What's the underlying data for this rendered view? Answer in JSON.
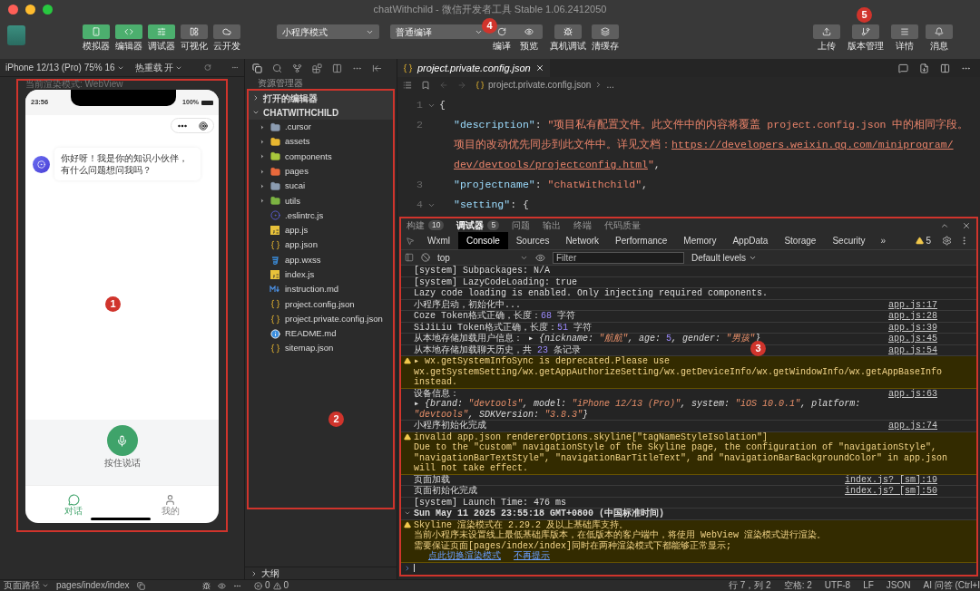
{
  "window": {
    "title": "chatWithchild - 微信开发者工具 Stable 1.06.2412050"
  },
  "toolbar": {
    "view_buttons": [
      {
        "label": "模拟器",
        "on": true
      },
      {
        "label": "编辑器",
        "on": true
      },
      {
        "label": "调试器",
        "on": true
      },
      {
        "label": "可视化",
        "on": false
      },
      {
        "label": "云开发",
        "on": false
      }
    ],
    "mode_select": "小程序模式",
    "compile_select": "普通编译",
    "compile_buttons": [
      "编译",
      "预览"
    ],
    "compile_marker": "4",
    "tool_buttons": [
      "真机调试",
      "清缓存"
    ],
    "right_buttons": [
      {
        "label": "上传"
      },
      {
        "label": "版本管理",
        "marker": "5"
      },
      {
        "label": "详情"
      },
      {
        "label": "消息"
      }
    ]
  },
  "simulator": {
    "device": "iPhone 12/13 (Pro) 75% 16",
    "hot_reload": "热重载 开",
    "render_mode": "当前渲染模式: WebView",
    "marker": "1",
    "phone": {
      "time": "23:56",
      "battery": "100%",
      "greeting": "你好呀！我是你的知识小伙伴，有什么问题想问我吗？",
      "mic_label": "按住说话",
      "tabs": [
        {
          "label": "对话",
          "selected": true
        },
        {
          "label": "我的",
          "selected": false
        }
      ]
    }
  },
  "explorer": {
    "title": "资源管理器",
    "marker": "2",
    "sections": [
      {
        "label": "打开的编辑器",
        "expanded": false
      },
      {
        "label": "CHATWITHCHILD",
        "expanded": true
      }
    ],
    "files": [
      {
        "name": ".cursor",
        "kind": "folder",
        "color": "#8b9bb0"
      },
      {
        "name": "assets",
        "kind": "folder",
        "color": "#e8b730"
      },
      {
        "name": "components",
        "kind": "folder",
        "color": "#a8c83c"
      },
      {
        "name": "pages",
        "kind": "folder",
        "color": "#e8693c"
      },
      {
        "name": "sucai",
        "kind": "folder",
        "color": "#8b9bb0"
      },
      {
        "name": "utils",
        "kind": "folder",
        "color": "#7cb342"
      },
      {
        "name": ".eslintrc.js",
        "kind": "eslint"
      },
      {
        "name": "app.js",
        "kind": "js"
      },
      {
        "name": "app.json",
        "kind": "json"
      },
      {
        "name": "app.wxss",
        "kind": "css"
      },
      {
        "name": "index.js",
        "kind": "js"
      },
      {
        "name": "instruction.md",
        "kind": "md"
      },
      {
        "name": "project.config.json",
        "kind": "json"
      },
      {
        "name": "project.private.config.json",
        "kind": "json"
      },
      {
        "name": "README.md",
        "kind": "info"
      },
      {
        "name": "sitemap.json",
        "kind": "json"
      }
    ],
    "outline": "大纲",
    "errors": "0",
    "warnings": "0"
  },
  "editor": {
    "tab": "project.private.config.json",
    "breadcrumb": "project.private.config.json",
    "breadcrumb_more": "...",
    "lines": [
      {
        "number": "1",
        "foldable": true,
        "parts": [
          {
            "text": "{",
            "kind": "punct"
          }
        ]
      },
      {
        "number": "2",
        "foldable": false,
        "parts": [
          {
            "text": "\"description\"",
            "kind": "key"
          },
          {
            "text": ": ",
            "kind": "punct"
          },
          {
            "text": "\"项目私有配置文件。此文件中的内容将覆盖 project.config.json 中的相同字段。",
            "kind": "string"
          }
        ]
      },
      {
        "foldable": false,
        "parts": [
          {
            "text": "项目的改动优先同步到此文件中。详见文档：",
            "kind": "string"
          },
          {
            "text": "https://developers.weixin.qq.com/miniprogram/",
            "kind": "link"
          }
        ]
      },
      {
        "foldable": false,
        "parts": [
          {
            "text": "dev/devtools/projectconfig.html",
            "kind": "link"
          },
          {
            "text": "\"",
            "kind": "string"
          },
          {
            "text": ",",
            "kind": "punct"
          }
        ]
      },
      {
        "number": "3",
        "foldable": false,
        "parts": [
          {
            "text": "\"projectname\"",
            "kind": "key"
          },
          {
            "text": ": ",
            "kind": "punct"
          },
          {
            "text": "\"chatWithchild\"",
            "kind": "string"
          },
          {
            "text": ",",
            "kind": "punct"
          }
        ]
      },
      {
        "number": "4",
        "foldable": true,
        "parts": [
          {
            "text": "\"setting\"",
            "kind": "key"
          },
          {
            "text": ": {",
            "kind": "punct"
          }
        ]
      }
    ]
  },
  "panel": {
    "marker": "3",
    "tabs": [
      {
        "label": "构建",
        "count": "10",
        "selected": false
      },
      {
        "label": "调试器",
        "count": "5",
        "selected": true
      },
      {
        "label": "问题",
        "selected": false
      },
      {
        "label": "输出",
        "selected": false
      },
      {
        "label": "终端",
        "selected": false
      },
      {
        "label": "代码质量",
        "selected": false
      }
    ],
    "devtools_tabs": [
      {
        "label": "Wxml",
        "selected": false
      },
      {
        "label": "Console",
        "selected": true
      },
      {
        "label": "Sources",
        "selected": false
      },
      {
        "label": "Network",
        "selected": false
      },
      {
        "label": "Performance",
        "selected": false
      },
      {
        "label": "Memory",
        "selected": false
      },
      {
        "label": "AppData",
        "selected": false
      },
      {
        "label": "Storage",
        "selected": false
      },
      {
        "label": "Security",
        "selected": false
      }
    ],
    "more_tabs": "»",
    "warning_count": "5",
    "context": "top",
    "filter_placeholder": "Filter",
    "levels": "Default levels",
    "logs": [
      {
        "kind": "log",
        "lines": [
          [
            {
              "text": "[system] Subpackages: N/A",
              "kind": "plain"
            }
          ]
        ]
      },
      {
        "kind": "log",
        "lines": [
          [
            {
              "text": "[system] LazyCodeLoading: true",
              "kind": "plain"
            }
          ]
        ]
      },
      {
        "kind": "log",
        "lines": [
          [
            {
              "text": "Lazy code loading is enabled. Only injecting required components.",
              "kind": "plain"
            }
          ]
        ]
      },
      {
        "kind": "log",
        "source": "app.js:17",
        "lines": [
          [
            {
              "text": "小程序启动，初始化中...",
              "kind": "plain"
            }
          ]
        ]
      },
      {
        "kind": "log",
        "source": "app.js:28",
        "lines": [
          [
            {
              "text": "Coze Token格式正确，长度：",
              "kind": "plain"
            },
            {
              "text": "68",
              "kind": "num"
            },
            {
              "text": " 字符",
              "kind": "plain"
            }
          ]
        ]
      },
      {
        "kind": "log",
        "source": "app.js:39",
        "lines": [
          [
            {
              "text": "SiJiLiu Token格式正确，长度：",
              "kind": "plain"
            },
            {
              "text": "51",
              "kind": "num"
            },
            {
              "text": " 字符",
              "kind": "plain"
            }
          ]
        ]
      },
      {
        "kind": "log",
        "source": "app.js:45",
        "lines": [
          [
            {
              "text": "从本地存储加载用户信息： ▸ ",
              "kind": "plain"
            },
            {
              "text": "{nickname: ",
              "kind": "obj"
            },
            {
              "text": "\"航航\"",
              "kind": "str"
            },
            {
              "text": ", age: ",
              "kind": "obj"
            },
            {
              "text": "5",
              "kind": "num"
            },
            {
              "text": ", gender: ",
              "kind": "obj"
            },
            {
              "text": "\"男孩\"",
              "kind": "str"
            },
            {
              "text": "}",
              "kind": "obj"
            }
          ]
        ]
      },
      {
        "kind": "log",
        "source": "app.js:54",
        "lines": [
          [
            {
              "text": "从本地存储加载聊天历史，共 ",
              "kind": "plain"
            },
            {
              "text": "23",
              "kind": "num"
            },
            {
              "text": " 条记录",
              "kind": "plain"
            }
          ]
        ]
      },
      {
        "kind": "warn",
        "lines": [
          [
            {
              "text": "▸ wx.getSystemInfoSync is deprecated.Please use",
              "kind": "plain"
            }
          ],
          [
            {
              "text": "wx.getSystemSetting/wx.getAppAuthorizeSetting/wx.getDeviceInfo/wx.getWindowInfo/wx.getAppBaseInfo instead.",
              "kind": "plain"
            }
          ]
        ]
      },
      {
        "kind": "log",
        "source": "app.js:63",
        "lines": [
          [
            {
              "text": "设备信息：",
              "kind": "plain"
            }
          ],
          [
            {
              "text": "▸ {brand: ",
              "kind": "obj"
            },
            {
              "text": "\"devtools\"",
              "kind": "str"
            },
            {
              "text": ", model: ",
              "kind": "obj"
            },
            {
              "text": "\"iPhone 12/13 (Pro)\"",
              "kind": "str"
            },
            {
              "text": ", system: ",
              "kind": "obj"
            },
            {
              "text": "\"iOS 10.0.1\"",
              "kind": "str"
            },
            {
              "text": ", platform: ",
              "kind": "obj"
            },
            {
              "text": "\"devtools\"",
              "kind": "str"
            },
            {
              "text": ", SDKVersion: ",
              "kind": "obj"
            },
            {
              "text": "\"3.8.3\"",
              "kind": "str"
            },
            {
              "text": "}",
              "kind": "obj"
            }
          ]
        ]
      },
      {
        "kind": "log",
        "source": "app.js:74",
        "lines": [
          [
            {
              "text": "小程序初始化完成",
              "kind": "plain"
            }
          ]
        ]
      },
      {
        "kind": "warn",
        "lines": [
          [
            {
              "text": "invalid app.json rendererOptions.skyline[\"tagNameStyleIsolation\"]",
              "kind": "plain"
            }
          ],
          [
            {
              "text": "Due to the \"custom\" navigationStyle of the Skyline page, the configuration of \"navigationStyle\", \"navigationBarTextStyle\", \"navigationBarTitleText\", and \"navigationBarBackgroundColor\" in app.json will not take effect.",
              "kind": "plain"
            }
          ]
        ]
      },
      {
        "kind": "log",
        "source": "index.js? [sm]:19",
        "lines": [
          [
            {
              "text": "页面加载",
              "kind": "plain"
            }
          ]
        ]
      },
      {
        "kind": "log",
        "source": "index.js? [sm]:50",
        "lines": [
          [
            {
              "text": "页面初始化完成",
              "kind": "plain"
            }
          ]
        ]
      },
      {
        "kind": "log",
        "lines": [
          [
            {
              "text": "[system] Launch Time: 476 ms",
              "kind": "plain"
            }
          ]
        ]
      },
      {
        "kind": "group",
        "lines": [
          [
            {
              "text": "Sun May 11 2025 23:55:18 GMT+0800 (中国标准时间)",
              "kind": "plain"
            }
          ]
        ]
      },
      {
        "kind": "warn",
        "lines": [
          [
            {
              "text": "Skyline 渲染模式在 2.29.2 及以上基础库支持。",
              "kind": "plain"
            }
          ],
          [
            {
              "text": "当前小程序未设置线上最低基础库版本，在低版本的客户端中，将使用 WebView 渲染模式进行渲染。",
              "kind": "plain"
            }
          ],
          [
            {
              "text": "需要保证页面[pages/index/index]同时在两种渲染模式下都能够正常显示;",
              "kind": "plain"
            }
          ],
          [
            {
              "text": "点此切换渲染模式",
              "kind": "link"
            },
            {
              "text": "不再提示",
              "kind": "link"
            }
          ]
        ]
      }
    ]
  },
  "status_bar": {
    "page_path": "页面路径",
    "path": "pages/index/index",
    "items": [
      "行 7，列 2",
      "空格: 2",
      "UTF-8",
      "LF",
      "JSON",
      "AI 问答 (Ctrl+I"
    ]
  }
}
